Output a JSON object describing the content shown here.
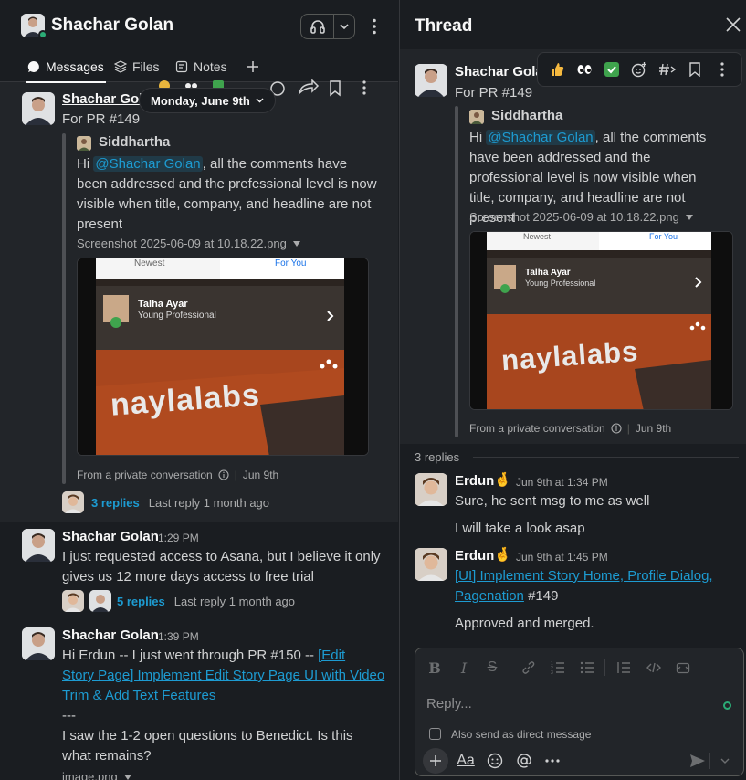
{
  "channel": {
    "name": "Shachar Golan",
    "tabs": [
      "Messages",
      "Files",
      "Notes"
    ]
  },
  "date_divider": "Monday, June 9th",
  "left_messages": [
    {
      "sender": "Shachar Gol",
      "text": "For PR #149",
      "quote": {
        "name": "Siddhartha",
        "prefix": "Hi ",
        "mention": "@Shachar Golan",
        "body_line1": ", all the comments have",
        "body_rest": [
          "been addressed and the prefessional level is now",
          "visible when title, company, and headline are not",
          "present"
        ],
        "file": "Screenshot 2025-06-09 at 10.18.22.png",
        "from": "From a private conversation",
        "from_date": "Jun 9th"
      },
      "replies": {
        "count": "3 replies",
        "last": "Last reply 1 month ago"
      }
    },
    {
      "sender": "Shachar Golan",
      "time": "1:29 PM",
      "lines": [
        "I just requested access to Asana, but I believe it only",
        "gives us 12 more days access to free trial"
      ],
      "replies": {
        "count": "5 replies",
        "last": "Last reply 1 month ago"
      }
    },
    {
      "sender": "Shachar Golan",
      "time": "1:39 PM",
      "line1_prefix": "Hi Erdun -- I just went through PR #150 -- ",
      "link_parts": [
        "[Edit",
        "Story Page] Implement Edit Story Page UI with Video",
        "Trim & Add Text Features"
      ],
      "dashes": "---",
      "lines": [
        "I saw the 1-2 open questions to Benedict. Is this",
        "what remains?"
      ],
      "file": "image.png"
    }
  ],
  "screenshot": {
    "tab_newest": "Newest",
    "tab_foryou": "For You",
    "profile_name": "Talha Ayar",
    "profile_role": "Young Professional",
    "brand": "naylalabs"
  },
  "thread": {
    "title": "Thread",
    "parent": {
      "sender": "Shachar Golan",
      "text": "For PR #149",
      "quote_name": "Siddhartha",
      "quote_prefix": "Hi ",
      "quote_mention": "@Shachar Golan",
      "quote_line1": ", all the comments",
      "quote_rest": [
        "have been addressed and the",
        "professional level is now visible when",
        "title, company, and headline are not",
        "present"
      ],
      "file": "Screenshot 2025-06-09 at 10.18.22.png",
      "from": "From a private conversation",
      "from_date": "Jun 9th"
    },
    "reply_count": "3 replies",
    "replies": [
      {
        "sender": "Erdun",
        "emoji": "🤞",
        "time": "Jun 9th at 1:34 PM",
        "lines": [
          "Sure, he sent msg to me as well",
          "I will take a look asap"
        ]
      },
      {
        "sender": "Erdun",
        "emoji": "🤞",
        "time": "Jun 9th at 1:45 PM",
        "link_parts": [
          "[UI] Implement Story Home, Profile Dialog,",
          "Pagenation"
        ],
        "link_suffix": " #149",
        "after": "Approved and merged."
      }
    ],
    "composer": {
      "placeholder": "Reply...",
      "also_send": "Also send as direct message",
      "aa": "Aa"
    }
  },
  "colors": {
    "accent": "#1d9bd1",
    "online": "#2bac76",
    "background": "#1a1d21"
  }
}
